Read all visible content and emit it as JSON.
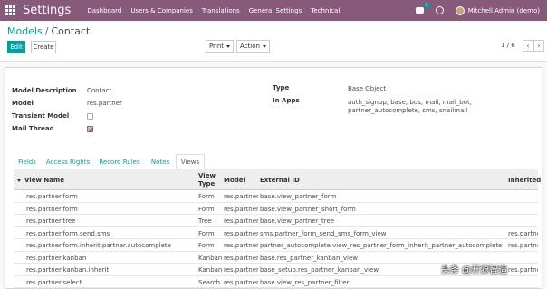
{
  "navbar": {
    "brand": "Settings",
    "menu": [
      "Dashboard",
      "Users & Companies",
      "Translations",
      "General Settings",
      "Technical"
    ],
    "chat_badge": "1",
    "user_name": "Mitchell Admin (demo)"
  },
  "breadcrumb": {
    "parent": "Models",
    "separator": "/",
    "current": "Contact"
  },
  "toolbar": {
    "edit_label": "Edit",
    "create_label": "Create",
    "print_label": "Print",
    "action_label": "Action"
  },
  "pager": {
    "text": "1 / 6",
    "prev": "‹",
    "next": "›"
  },
  "form": {
    "model_description_label": "Model Description",
    "model_description_value": "Contact",
    "model_label": "Model",
    "model_value": "res.partner",
    "transient_label": "Transient Model",
    "transient_checked": false,
    "mail_thread_label": "Mail Thread",
    "mail_thread_checked": true,
    "type_label": "Type",
    "type_value": "Base Object",
    "in_apps_label": "In Apps",
    "in_apps_line1": "auth_signup, base, bus, mail, mail_bot,",
    "in_apps_line2": "partner_autocomplete, sms, snailmail"
  },
  "tabs": [
    "Fields",
    "Access Rights",
    "Record Rules",
    "Notes",
    "Views"
  ],
  "active_tab": "Views",
  "table": {
    "headers": {
      "view_name": "View Name",
      "view_type_1": "View",
      "view_type_2": "Type",
      "model": "Model",
      "external_id": "External ID",
      "inherited": "Inherited"
    },
    "rows": [
      {
        "name": "res.partner.form",
        "type": "Form",
        "model": "res.partner",
        "xid": "base.view_partner_form",
        "inherited": ""
      },
      {
        "name": "res.partner.form",
        "type": "Form",
        "model": "res.partner",
        "xid": "base.view_partner_short_form",
        "inherited": ""
      },
      {
        "name": "res.partner.tree",
        "type": "Tree",
        "model": "res.partner",
        "xid": "base.view_partner_tree",
        "inherited": ""
      },
      {
        "name": "res.partner.form.send.sms",
        "type": "Form",
        "model": "res.partner",
        "xid": "sms.partner_form_send_sms_form_view",
        "inherited": "res.partne"
      },
      {
        "name": "res.partner.form.inherit.partner.autocomplete",
        "type": "Form",
        "model": "res.partner",
        "xid": "partner_autocomplete.view_res_partner_form_inherit_partner_autocomplete",
        "inherited": "res.partne"
      },
      {
        "name": "res.partner.kanban",
        "type": "Kanban",
        "model": "res.partner",
        "xid": "base.res_partner_kanban_view",
        "inherited": ""
      },
      {
        "name": "res.partner.kanban.inherit",
        "type": "Kanban",
        "model": "res.partner",
        "xid": "base_setup.res_partner_kanban_view",
        "inherited": "res.partne"
      },
      {
        "name": "res.partner.select",
        "type": "Search",
        "model": "res.partner",
        "xid": "base.view_res_partner_filter",
        "inherited": ""
      }
    ]
  },
  "watermark": "头条 @开源智造",
  "colors": {
    "navbar": "#875a7b",
    "accent": "#00a09d"
  }
}
